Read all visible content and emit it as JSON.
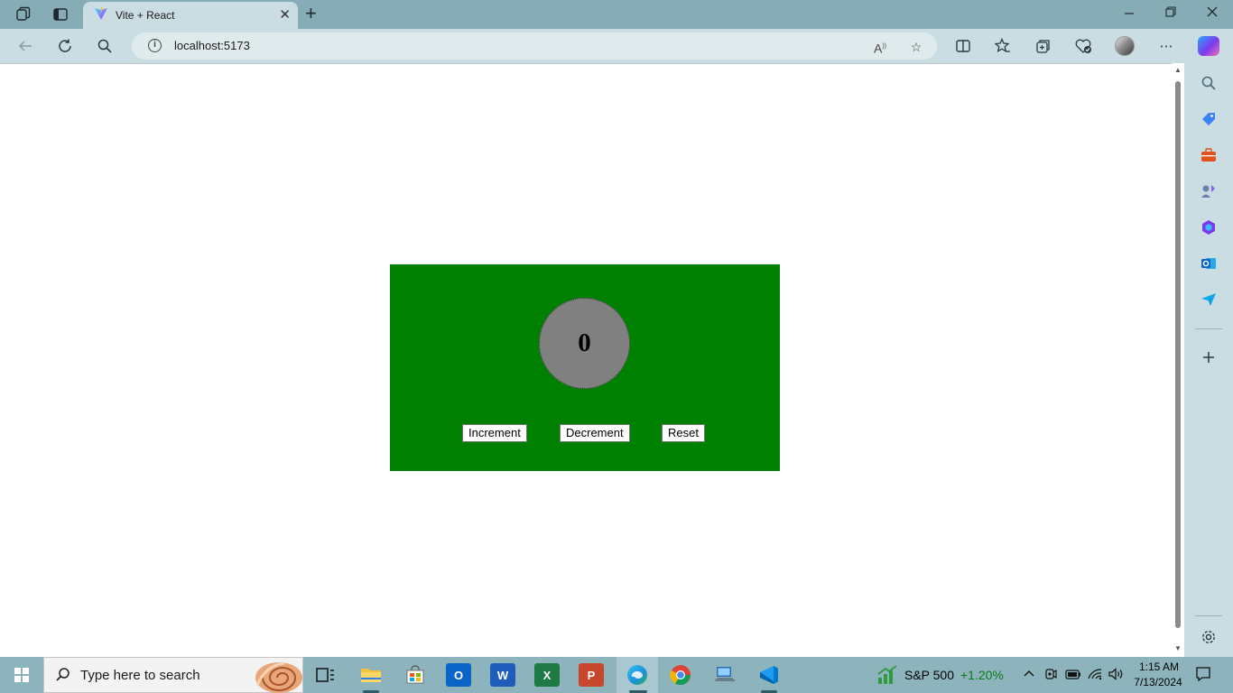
{
  "browser": {
    "tab_title": "Vite + React",
    "url": "localhost:5173",
    "new_tab_symbol": "+",
    "close_symbol": "✕"
  },
  "app": {
    "counter_value": "0",
    "buttons": {
      "increment": "Increment",
      "decrement": "Decrement",
      "reset": "Reset"
    },
    "colors": {
      "card_background": "#008000",
      "circle_background": "#808080"
    }
  },
  "taskbar": {
    "search_placeholder": "Type here to search",
    "stock": {
      "name": "S&P 500",
      "change": "+1.20%"
    },
    "clock": {
      "time": "1:15 AM",
      "date": "7/13/2024"
    }
  }
}
